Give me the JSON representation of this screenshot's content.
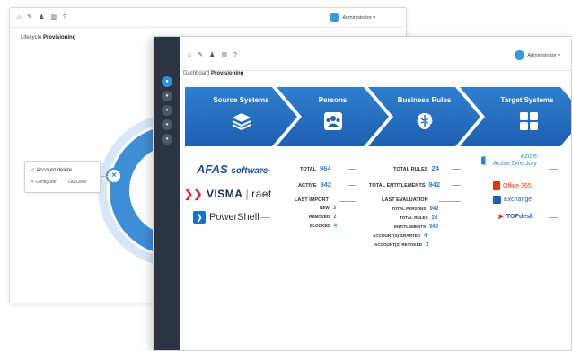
{
  "back": {
    "user": "Administrator ▾",
    "breadcrumb_prefix": "Lifecycle",
    "breadcrumb_current": "Provisioning",
    "card_title": "Account delete",
    "configure_label": "Configurer",
    "clear_label": "Clear"
  },
  "front": {
    "user": "Administrator ▾",
    "breadcrumb_prefix": "Dashboard",
    "breadcrumb_current": "Provisioning",
    "stages": [
      {
        "label": "Source Systems",
        "icon": "layers-icon"
      },
      {
        "label": "Persons",
        "icon": "persons-icon"
      },
      {
        "label": "Business Rules",
        "icon": "brain-icon"
      },
      {
        "label": "Target Systems",
        "icon": "grid-icon"
      }
    ],
    "sources": {
      "afas": "AFAS",
      "afas_sub": "software",
      "visma": "VISMA",
      "raet": "raet",
      "powershell": "PowerShell"
    },
    "persons": {
      "total_label": "TOTAL",
      "total_value": "964",
      "active_label": "ACTIVE",
      "active_value": "942",
      "last_import_label": "LAST IMPORT",
      "new_label": "NEW",
      "new_value": "3",
      "removed_label": "REMOVED",
      "removed_value": "2",
      "blocked_label": "BLOCKED",
      "blocked_value": "4"
    },
    "rules": {
      "total_rules_label": "TOTAL RULES",
      "total_rules_value": "24",
      "total_entitlements_label": "TOTAL ENTITLEMENTS",
      "total_entitlements_value": "942",
      "last_eval_label": "LAST EVALUATION",
      "tp_label": "TOTAL PERSONS",
      "tp_value": "942",
      "tr_label": "TOTAL RULES",
      "tr_value": "24",
      "ent_label": "ENTITLEMENTS",
      "ent_value": "942",
      "granted_label": "ACCOUNT(S) GRANTED",
      "granted_value": "4",
      "revoked_label": "ACCOUNT(S) REVOKED",
      "revoked_value": "2"
    },
    "targets": {
      "azure_1": "Azure",
      "azure_2": "Active Directory",
      "office": "Office 365",
      "exchange": "Exchange",
      "topdesk": "TOPdesk"
    }
  }
}
